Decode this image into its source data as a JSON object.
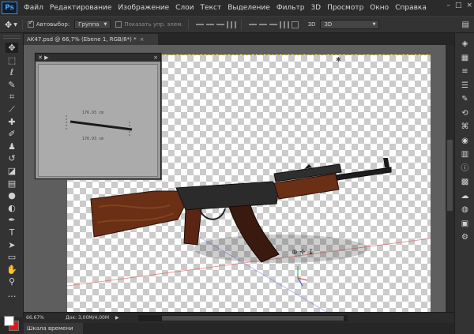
{
  "app": {
    "logo": "Ps"
  },
  "menu": [
    "Файл",
    "Редактирование",
    "Изображение",
    "Слои",
    "Текст",
    "Выделение",
    "Фильтр",
    "3D",
    "Просмотр",
    "Окно",
    "Справка"
  ],
  "window_controls": {
    "minimize": "–",
    "maximize": "□",
    "close": "×"
  },
  "options": {
    "autoselect_label": "Автовыбор:",
    "autoselect_checked": true,
    "autoselect_value": "Группа",
    "transform_label": "Показать упр. элем.",
    "mode3d_label": "3D",
    "mode3d_value": "3D"
  },
  "document_tab": {
    "title": "AK47.psd @ 66,7% (Ebene 1, RGB/8*) *",
    "close": "×"
  },
  "tools": [
    {
      "name": "move-tool",
      "glyph": "✥",
      "active": true
    },
    {
      "name": "marquee-tool",
      "glyph": "⬚"
    },
    {
      "name": "lasso-tool",
      "glyph": "ℓ"
    },
    {
      "name": "quick-select-tool",
      "glyph": "✎"
    },
    {
      "name": "crop-tool",
      "glyph": "⌗"
    },
    {
      "name": "eyedropper-tool",
      "glyph": "⟋"
    },
    {
      "name": "healing-tool",
      "glyph": "✚"
    },
    {
      "name": "brush-tool",
      "glyph": "✐"
    },
    {
      "name": "stamp-tool",
      "glyph": "♟"
    },
    {
      "name": "history-brush-tool",
      "glyph": "↺"
    },
    {
      "name": "eraser-tool",
      "glyph": "◪"
    },
    {
      "name": "gradient-tool",
      "glyph": "▤"
    },
    {
      "name": "blur-tool",
      "glyph": "●"
    },
    {
      "name": "dodge-tool",
      "glyph": "◐"
    },
    {
      "name": "pen-tool",
      "glyph": "✒"
    },
    {
      "name": "type-tool",
      "glyph": "T"
    },
    {
      "name": "path-select-tool",
      "glyph": "➤"
    },
    {
      "name": "shape-tool",
      "glyph": "▭"
    },
    {
      "name": "hand-tool",
      "glyph": "✋"
    },
    {
      "name": "zoom-tool",
      "glyph": "⚲"
    },
    {
      "name": "more-tools",
      "glyph": "…"
    }
  ],
  "right_tools": [
    {
      "name": "3d-panel-icon",
      "glyph": "◈"
    },
    {
      "name": "layers-panel-icon",
      "glyph": "▦"
    },
    {
      "name": "adjustments-panel-icon",
      "glyph": "≡"
    },
    {
      "name": "properties-panel-icon",
      "glyph": "☰"
    },
    {
      "name": "brush-panel-icon",
      "glyph": "✎"
    },
    {
      "name": "history-panel-icon",
      "glyph": "⟲"
    },
    {
      "name": "paths-panel-icon",
      "glyph": "⌘"
    },
    {
      "name": "channels-panel-icon",
      "glyph": "◉"
    },
    {
      "name": "styles-panel-icon",
      "glyph": "▥"
    },
    {
      "name": "info-panel-icon",
      "glyph": "ⓘ"
    },
    {
      "name": "swatches-panel-icon",
      "glyph": "▩"
    },
    {
      "name": "libraries-panel-icon",
      "glyph": "☁"
    },
    {
      "name": "color-panel-icon",
      "glyph": "◍"
    },
    {
      "name": "cube-panel-icon",
      "glyph": "▣"
    },
    {
      "name": "actions-panel-icon",
      "glyph": "⚙"
    }
  ],
  "camera_view": {
    "dim_label": "176.93 cm",
    "close": "×"
  },
  "status": {
    "zoom": "66.67%",
    "doc_info": "Док: 3,00M/4,00M",
    "arrow": "▶"
  },
  "timeline": {
    "tab_label": "Шкала времени"
  },
  "colors": {
    "foreground": "#ffffff",
    "background": "#d41f1f",
    "accent": "#4aa3f0"
  }
}
